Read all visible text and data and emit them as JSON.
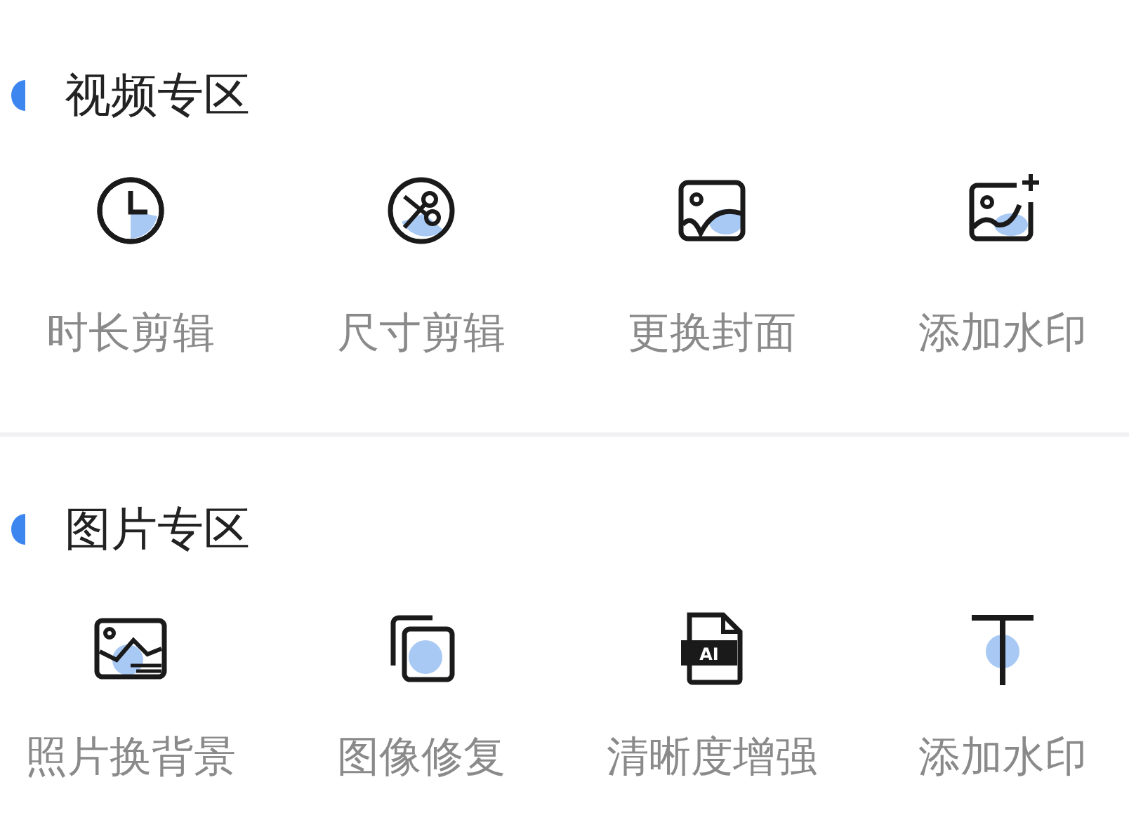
{
  "sections": [
    {
      "title": "视频专区",
      "items": [
        {
          "kind": "clock",
          "label": "时长剪辑"
        },
        {
          "kind": "scissors",
          "label": "尺寸剪辑"
        },
        {
          "kind": "image",
          "label": "更换封面"
        },
        {
          "kind": "image-add",
          "label": "添加水印"
        }
      ]
    },
    {
      "title": "图片专区",
      "items": [
        {
          "kind": "landscape",
          "label": "照片换背景"
        },
        {
          "kind": "copy",
          "label": "图像修复"
        },
        {
          "kind": "file",
          "label": "清晰度增强",
          "badge": "AI"
        },
        {
          "kind": "text",
          "label": "添加水印"
        }
      ]
    }
  ]
}
